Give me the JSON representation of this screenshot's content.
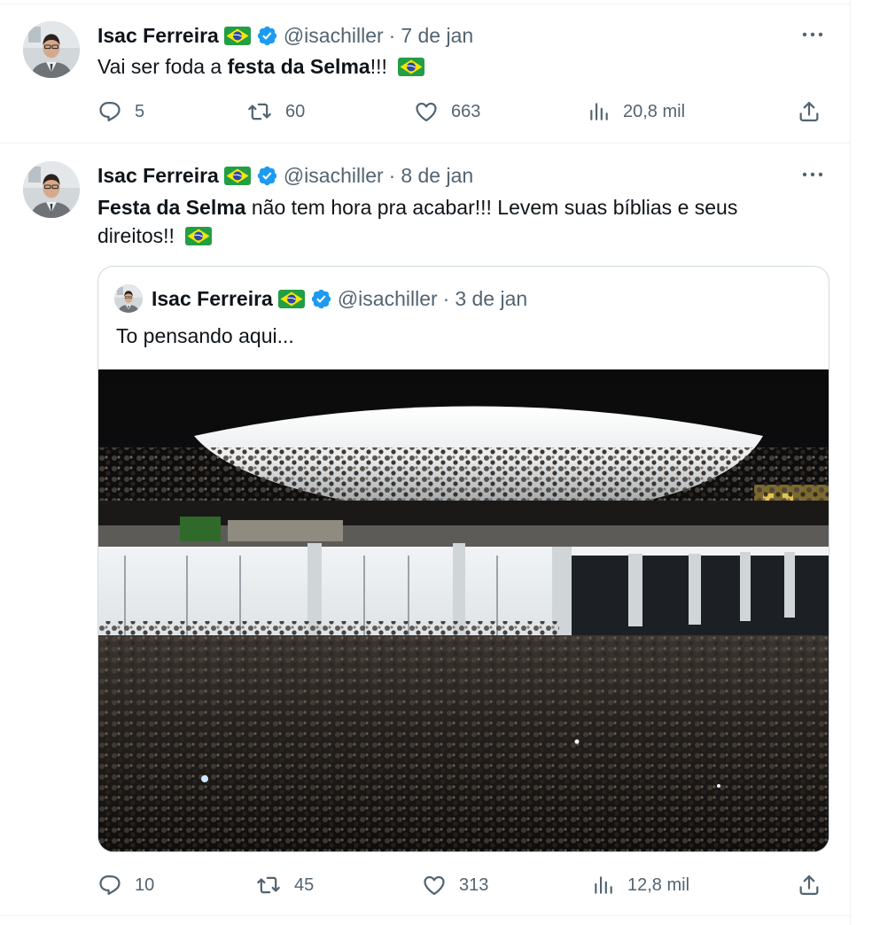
{
  "tweets": [
    {
      "author": {
        "name": "Isac Ferreira",
        "handle": "@isachiller",
        "flag": "flag-brazil-icon"
      },
      "date": "7 de jan",
      "text": {
        "pre": "Vai ser foda a ",
        "bold": "festa da Selma",
        "post": "!!!"
      },
      "stats": {
        "replies": "5",
        "retweets": "60",
        "likes": "663",
        "views": "20,8 mil"
      }
    },
    {
      "author": {
        "name": "Isac Ferreira",
        "handle": "@isachiller",
        "flag": "flag-brazil-icon"
      },
      "date": "8 de jan",
      "text": {
        "bold": "Festa da Selma",
        "post": " não tem hora pra acabar!!! Levem suas bíblias e seus direitos!!"
      },
      "quote": {
        "author": {
          "name": "Isac Ferreira",
          "handle": "@isachiller"
        },
        "date": "3 de jan",
        "text": "To pensando aqui..."
      },
      "stats": {
        "replies": "10",
        "retweets": "45",
        "likes": "313",
        "views": "12,8 mil"
      }
    }
  ],
  "separator": "·",
  "colors": {
    "text": "#0f1419",
    "secondary": "#536471",
    "verified": "#1d9bf0",
    "border": "#cfd9de",
    "divider": "#eff3f4"
  }
}
